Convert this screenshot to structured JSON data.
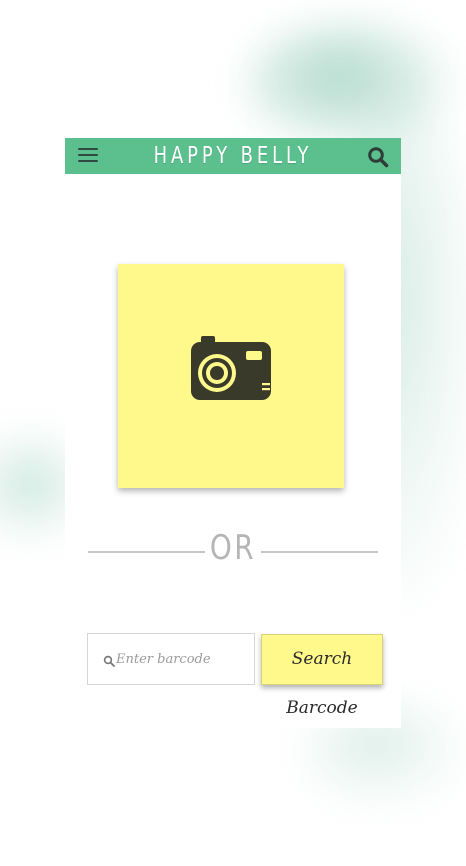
{
  "app": {
    "title": "HAPPY BELLY"
  },
  "header": {
    "menu_icon": "hamburger-menu-icon",
    "search_icon": "search-icon"
  },
  "scanner": {
    "icon": "camera-icon",
    "tile_color": "#fff98c"
  },
  "divider": {
    "text": "OR"
  },
  "barcode": {
    "placeholder": "Enter barcode",
    "value": "",
    "button_label": "Search Barcode"
  },
  "colors": {
    "header_bg": "#5cc08e",
    "accent_yellow": "#fff98c",
    "icon_dark": "#3a3a2a"
  }
}
